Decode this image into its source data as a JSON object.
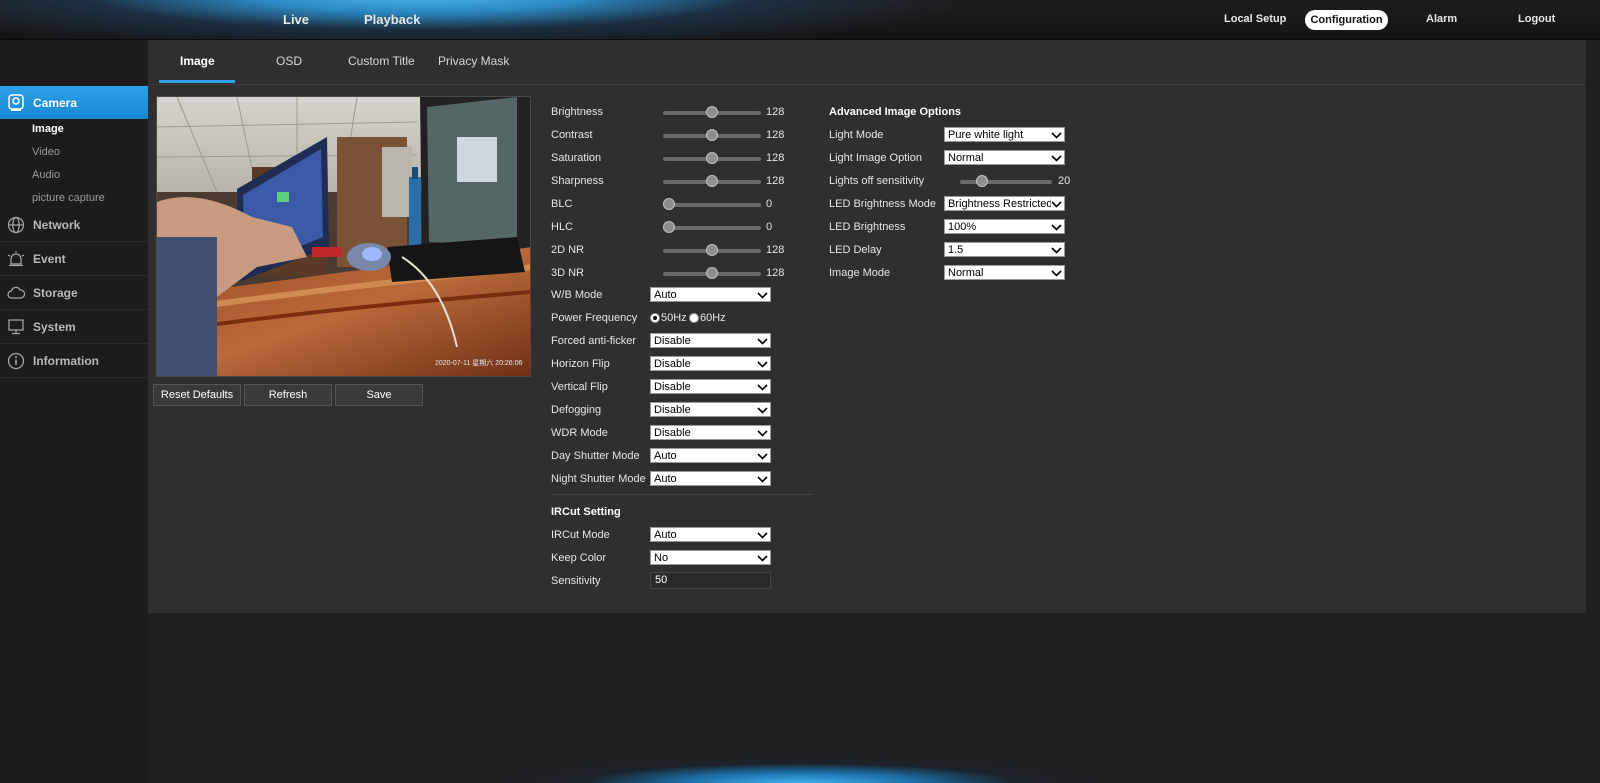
{
  "topnav": {
    "live": "Live",
    "playback": "Playback",
    "local_setup": "Local Setup",
    "configuration": "Configuration",
    "alarm": "Alarm",
    "logout": "Logout"
  },
  "sidebar": {
    "camera": "Camera",
    "camera_subitems": [
      "Image",
      "Video",
      "Audio",
      "picture capture"
    ],
    "sections": [
      "Network",
      "Event",
      "Storage",
      "System",
      "Information"
    ]
  },
  "tabs": [
    "Image",
    "OSD",
    "Custom Title",
    "Privacy Mask"
  ],
  "preview": {
    "timestamp": "2020-07-11  星期六  20:26:06"
  },
  "buttons": {
    "reset": "Reset Defaults",
    "refresh": "Refresh",
    "save": "Save"
  },
  "image_settings": {
    "brightness": {
      "label": "Brightness",
      "value": "128",
      "level": 0.5
    },
    "contrast": {
      "label": "Contrast",
      "value": "128",
      "level": 0.5
    },
    "saturation": {
      "label": "Saturation",
      "value": "128",
      "level": 0.5
    },
    "sharpness": {
      "label": "Sharpness",
      "value": "128",
      "level": 0.5
    },
    "blc": {
      "label": "BLC",
      "value": "0",
      "level": 0
    },
    "hlc": {
      "label": "HLC",
      "value": "0",
      "level": 0
    },
    "nr2d": {
      "label": "2D NR",
      "value": "128",
      "level": 0.5
    },
    "nr3d": {
      "label": "3D NR",
      "value": "128",
      "level": 0.5
    },
    "wb_mode": {
      "label": "W/B Mode",
      "value": "Auto"
    },
    "power_frequency": {
      "label": "Power Frequency",
      "opt1": "50Hz",
      "opt2": "60Hz",
      "selected": "50Hz"
    },
    "anti_flicker": {
      "label": "Forced anti-ficker",
      "value": "Disable"
    },
    "horizon_flip": {
      "label": "Horizon Flip",
      "value": "Disable"
    },
    "vertical_flip": {
      "label": "Vertical Flip",
      "value": "Disable"
    },
    "defogging": {
      "label": "Defogging",
      "value": "Disable"
    },
    "wdr_mode": {
      "label": "WDR Mode",
      "value": "Disable"
    },
    "day_shutter": {
      "label": "Day Shutter Mode",
      "value": "Auto"
    },
    "night_shutter": {
      "label": "Night Shutter Mode",
      "value": "Auto"
    }
  },
  "ircut": {
    "title": "IRCut Setting",
    "mode": {
      "label": "IRCut Mode",
      "value": "Auto"
    },
    "keep_color": {
      "label": "Keep Color",
      "value": "No"
    },
    "sensitivity": {
      "label": "Sensitivity",
      "value": "50"
    }
  },
  "advanced": {
    "title": "Advanced Image Options",
    "light_mode": {
      "label": "Light Mode",
      "value": "Pure white light"
    },
    "light_image_option": {
      "label": "Light Image Option",
      "value": "Normal"
    },
    "lights_off_sensitivity": {
      "label": "Lights off sensitivity",
      "value": "20",
      "level": 0.2
    },
    "led_brightness_mode": {
      "label": "LED Brightness Mode",
      "value": "Brightness Restricted"
    },
    "led_brightness": {
      "label": "LED Brightness",
      "value": "100%"
    },
    "led_delay": {
      "label": "LED Delay",
      "value": "1.5"
    },
    "image_mode": {
      "label": "Image Mode",
      "value": "Normal"
    }
  }
}
